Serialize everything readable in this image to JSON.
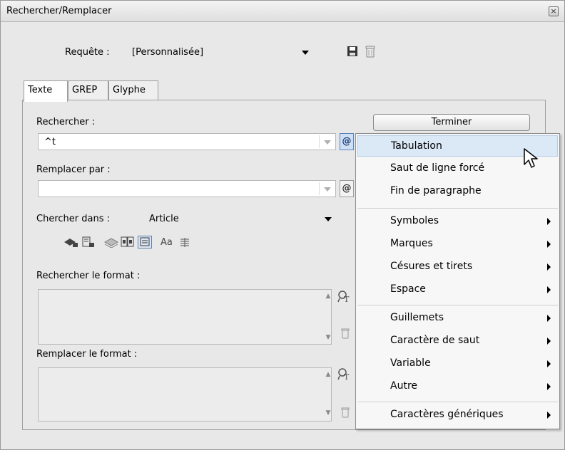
{
  "window": {
    "title": "Rechercher/Remplacer",
    "close_glyph": "×"
  },
  "query": {
    "label": "Requête :",
    "value": "[Personnalisée]"
  },
  "tabs": [
    {
      "label": "Texte",
      "active": true
    },
    {
      "label": "GREP",
      "active": false
    },
    {
      "label": "Glyphe",
      "active": false
    }
  ],
  "find": {
    "label": "Rechercher :",
    "value": "^t"
  },
  "replace": {
    "label": "Remplacer par :",
    "value": ""
  },
  "search_in": {
    "label": "Chercher dans :",
    "value": "Article"
  },
  "options_icons": [
    "locked-layers-icon",
    "locked-stories-icon",
    "hidden-layers-icon",
    "master-pages-icon",
    "footnotes-icon",
    "case-sensitive-icon",
    "whole-word-icon"
  ],
  "case_label": "Aa",
  "find_format": {
    "label": "Rechercher le format :"
  },
  "replace_format": {
    "label": "Remplacer le format :"
  },
  "done_button": "Terminer",
  "special_char_button": "@",
  "menu": {
    "items": [
      {
        "label": "Tabulation",
        "submenu": false,
        "highlighted": true
      },
      {
        "label": "Saut de ligne forcé",
        "submenu": false
      },
      {
        "label": "Fin de paragraphe",
        "submenu": false
      },
      {
        "label": "Symboles",
        "submenu": true
      },
      {
        "label": "Marques",
        "submenu": true
      },
      {
        "label": "Césures et tirets",
        "submenu": true
      },
      {
        "label": "Espace",
        "submenu": true
      },
      {
        "label": "Guillemets",
        "submenu": true
      },
      {
        "label": "Caractère de saut",
        "submenu": true
      },
      {
        "label": "Variable",
        "submenu": true
      },
      {
        "label": "Autre",
        "submenu": true
      },
      {
        "label": "Caractères génériques",
        "submenu": true
      }
    ]
  },
  "colors": {
    "highlight": "#dbe8f6",
    "panel": "#e8e8e8"
  }
}
